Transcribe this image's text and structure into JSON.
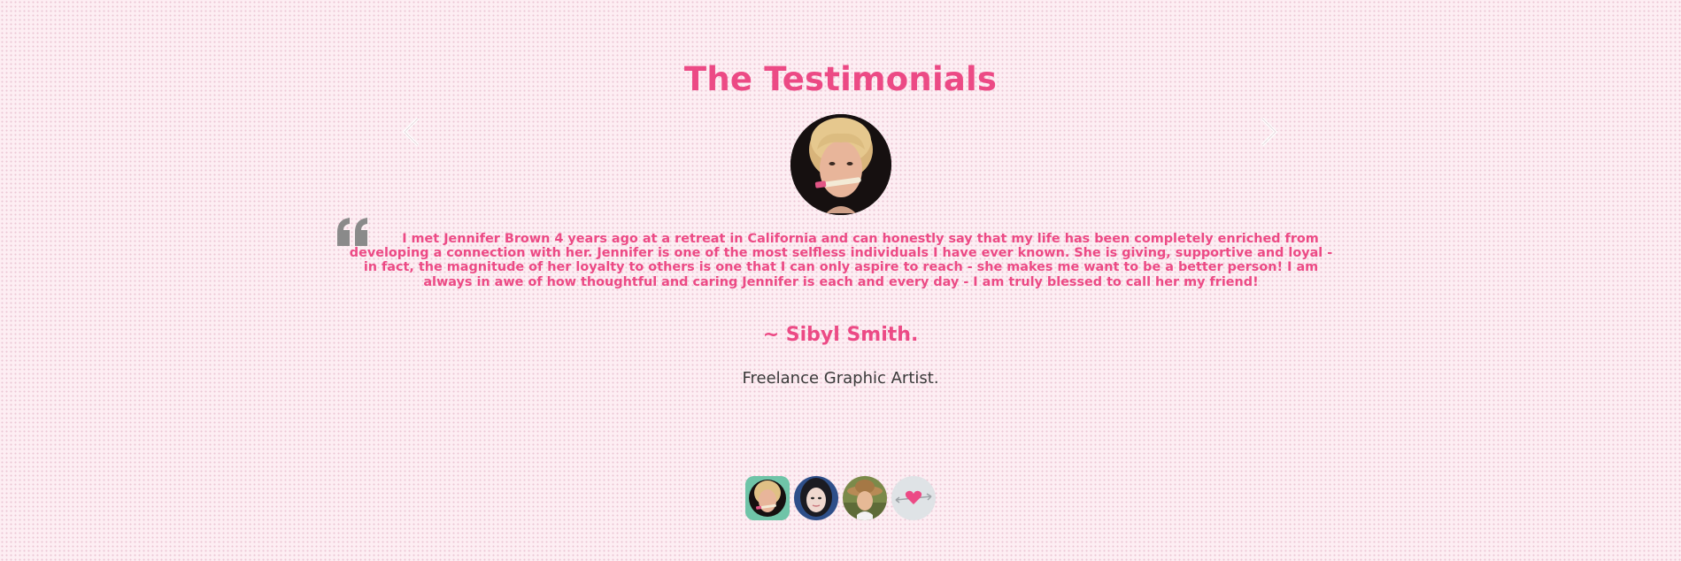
{
  "section": {
    "title": "The Testimonials"
  },
  "navigation": {
    "prev_icon": "chevron-left-icon",
    "next_icon": "chevron-right-icon"
  },
  "testimonial": {
    "quote_icon": "quote-left-icon",
    "text": "I met Jennifer Brown 4 years ago at a retreat in California and can honestly say that my life has been completely enriched from developing a connection with her. Jennifer is one of the most selfless individuals I have ever known. She is giving, supportive and loyal - in fact, the magnitude of her loyalty to others is one that I can only aspire to reach - she makes me want to be a better person! I am always in awe of how thoughtful and caring Jennifer is each and every day - I am truly blessed to call her my friend!",
    "author": "~ Sibyl Smith.",
    "role": "Freelance Graphic Artist."
  },
  "thumbnails": [
    {
      "name": "blonde-woman-thumbnail",
      "active": true
    },
    {
      "name": "dark-hair-woman-thumbnail",
      "active": false
    },
    {
      "name": "hat-woman-thumbnail",
      "active": false
    },
    {
      "name": "heart-arrow-thumbnail",
      "active": false
    }
  ],
  "colors": {
    "accent": "#ec4a85",
    "text_dark": "#3a3a3a",
    "quote_gray": "#8a8a8a",
    "background": "#fdeef3"
  }
}
